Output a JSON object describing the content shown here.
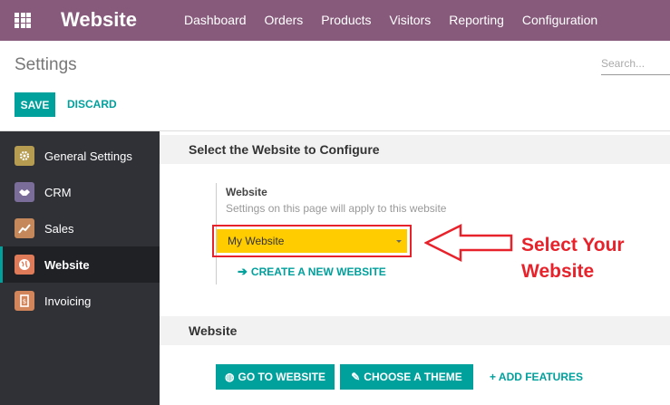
{
  "navbar": {
    "brand": "Website",
    "menu": [
      "Dashboard",
      "Orders",
      "Products",
      "Visitors",
      "Reporting",
      "Configuration"
    ]
  },
  "control": {
    "breadcrumb": "Settings",
    "search_placeholder": "Search...",
    "save_label": "SAVE",
    "discard_label": "DISCARD"
  },
  "sidebar": {
    "items": [
      {
        "label": "General Settings",
        "icon": "gear-icon",
        "color": "#b69c51"
      },
      {
        "label": "CRM",
        "icon": "handshake-icon",
        "color": "#7a6d9a"
      },
      {
        "label": "Sales",
        "icon": "chart-icon",
        "color": "#c5885a"
      },
      {
        "label": "Website",
        "icon": "globe-icon",
        "color": "#e07b5a",
        "active": true
      },
      {
        "label": "Invoicing",
        "icon": "invoice-icon",
        "color": "#d2855b"
      }
    ]
  },
  "main": {
    "section1_title": "Select the Website to Configure",
    "field_title": "Website",
    "field_help": "Settings on this page will apply to this website",
    "selected_website": "My Website",
    "create_link": "CREATE A NEW WEBSITE",
    "section2_title": "Website",
    "go_to_website": "GO TO WEBSITE",
    "choose_theme": "CHOOSE A THEME",
    "add_features": "+ ADD FEATURES"
  },
  "annotation": {
    "line1": "Select Your",
    "line2": "Website"
  },
  "colors": {
    "navbar": "#875a7b",
    "accent": "#00a09d",
    "highlight": "#ffcc00",
    "annotation": "#e8222b"
  }
}
